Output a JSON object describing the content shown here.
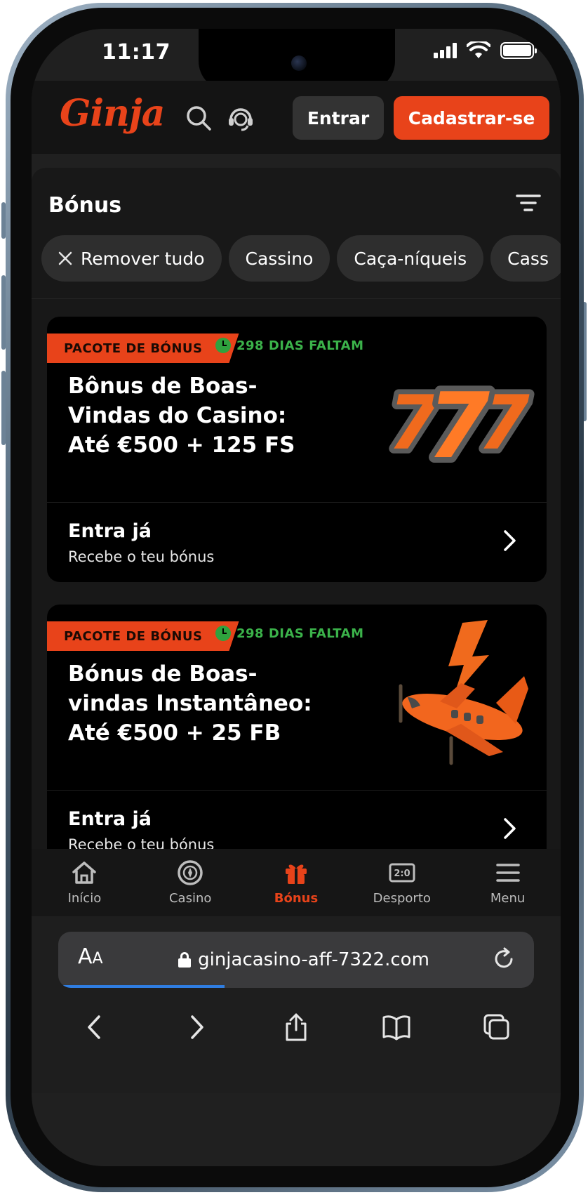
{
  "status_bar": {
    "time": "11:17"
  },
  "header": {
    "logo": "Ginja",
    "login_label": "Entrar",
    "signup_label": "Cadastrar-se",
    "brand_color": "#e8431a"
  },
  "page": {
    "title": "Bónus",
    "filters": [
      {
        "label": "Remover tudo",
        "has_close_icon": true
      },
      {
        "label": "Cassino"
      },
      {
        "label": "Caça-níqueis"
      },
      {
        "label": "Cass"
      }
    ]
  },
  "bonuses": [
    {
      "badge": "PACOTE DE BÓNUS",
      "days_left": "298 DIAS FALTAM",
      "title": "Bônus de Boas-Vindas do Casino: Até €500 + 125 FS",
      "image": "slot-777-icon",
      "cta_title": "Entra já",
      "cta_subtitle": "Recebe o teu bónus"
    },
    {
      "badge": "PACOTE DE BÓNUS",
      "days_left": "298 DIAS FALTAM",
      "title": "Bónus de Boas-vindas Instantâneo: Até €500 + 25 FB",
      "image": "airplane-lightning-icon",
      "cta_title": "Entra já",
      "cta_subtitle": "Recebe o teu bónus"
    }
  ],
  "bottom_nav": [
    {
      "label": "Início",
      "icon": "home-icon",
      "active": false
    },
    {
      "label": "Casino",
      "icon": "casino-chip-icon",
      "active": false
    },
    {
      "label": "Bónus",
      "icon": "gift-icon",
      "active": true
    },
    {
      "label": "Desporto",
      "icon": "scoreboard-icon",
      "active": false
    },
    {
      "label": "Menu",
      "icon": "hamburger-icon",
      "active": false
    }
  ],
  "browser": {
    "aa_label": "AA",
    "url": "ginjacasino-aff-7322.com",
    "load_progress": 0.35
  }
}
